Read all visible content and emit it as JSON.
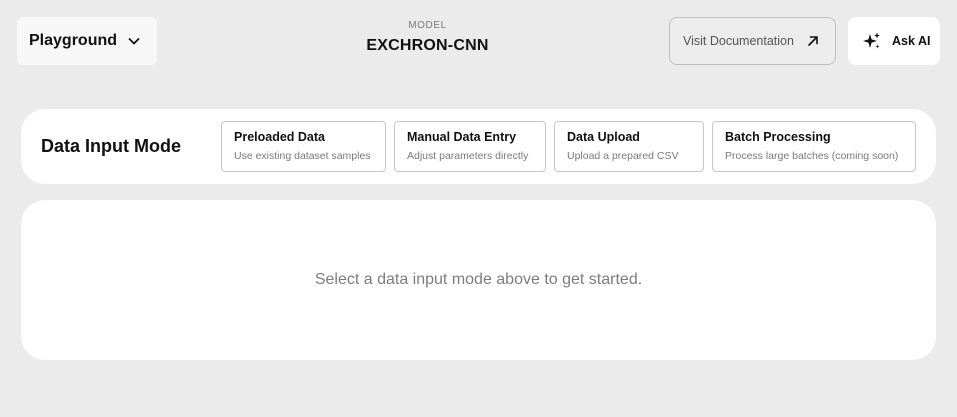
{
  "header": {
    "playground_label": "Playground",
    "model_label": "MODEL",
    "model_name": "EXCHRON-CNN",
    "docs_label": "Visit Documentation",
    "ask_ai_label": "Ask AI"
  },
  "data_input": {
    "title": "Data Input Mode",
    "options": [
      {
        "title": "Preloaded Data",
        "description": "Use existing dataset samples"
      },
      {
        "title": "Manual Data Entry",
        "description": "Adjust parameters directly"
      },
      {
        "title": "Data Upload",
        "description": "Upload a prepared CSV"
      },
      {
        "title": "Batch Processing",
        "description": "Process large batches (coming soon)"
      }
    ]
  },
  "main": {
    "empty_message": "Select a data input mode above to get started."
  },
  "icons": {
    "playground_dropdown": "chevron-down-icon",
    "docs": "arrow-up-right-icon",
    "ask_ai": "sparkles-icon"
  }
}
